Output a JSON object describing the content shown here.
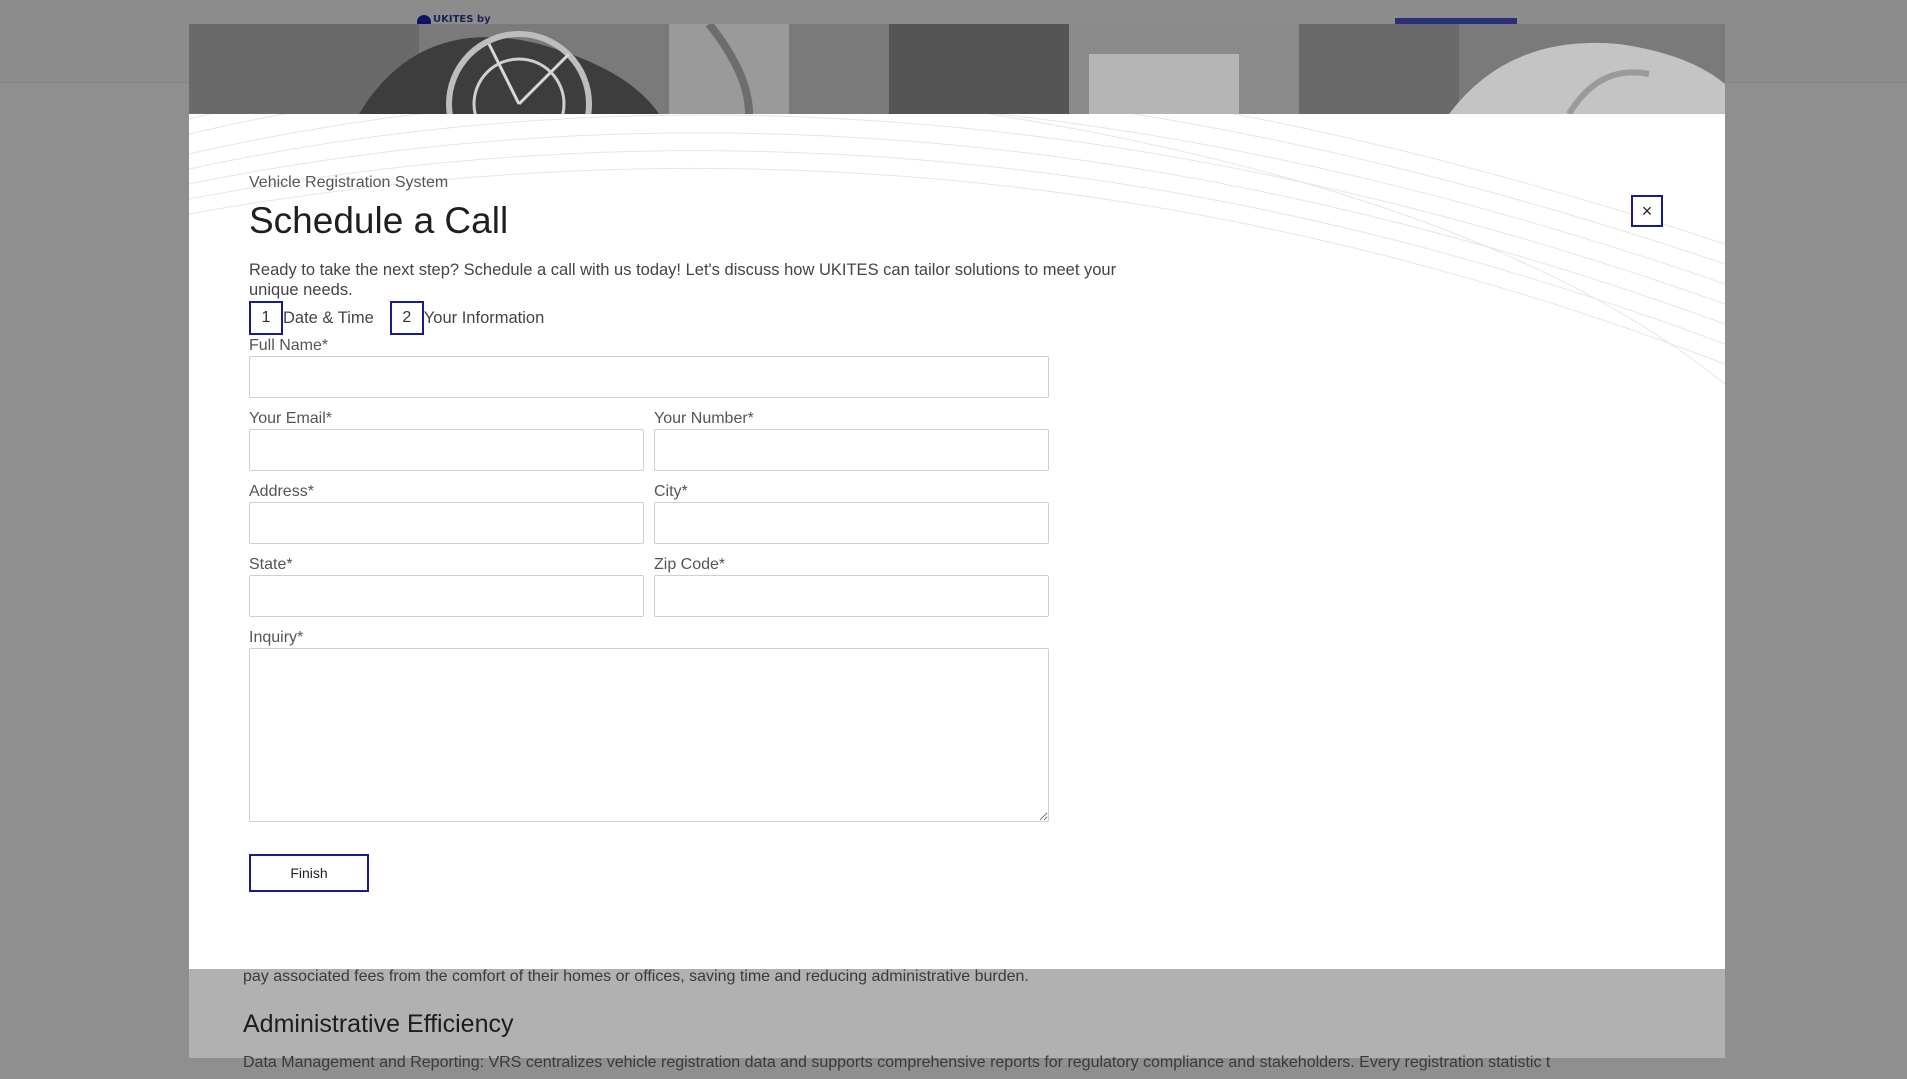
{
  "background": {
    "logo_text": "UKITES by",
    "paragraph": "pay associated fees from the comfort of their homes or offices, saving time and reducing administrative burden.",
    "heading": "Administrative Efficiency",
    "paragraph2": "Data Management and Reporting: VRS centralizes vehicle registration data and supports comprehensive reports for regulatory compliance and stakeholders. Every registration statistic t"
  },
  "modal": {
    "eyebrow": "Vehicle Registration System",
    "title": "Schedule a Call",
    "intro": "Ready to take the next step? Schedule a call with us today! Let's discuss how UKITES can tailor solutions to meet your unique needs.",
    "close_symbol": "×",
    "steps": [
      {
        "number": "1",
        "label": "Date & Time"
      },
      {
        "number": "2",
        "label": "Your Information"
      }
    ],
    "form": {
      "full_name_label": "Full Name*",
      "full_name_value": "",
      "email_label": "Your Email*",
      "email_value": "",
      "number_label": "Your Number*",
      "number_value": "",
      "address_label": "Address*",
      "address_value": "",
      "city_label": "City*",
      "city_value": "",
      "state_label": "State*",
      "state_value": "",
      "zip_label": "Zip Code*",
      "zip_value": "",
      "inquiry_label": "Inquiry*",
      "inquiry_value": "",
      "submit_label": "Finish"
    }
  },
  "colors": {
    "accent": "#1a1a8c",
    "overlay": "#8f8f8f",
    "modal_bg": "#ffffff"
  }
}
